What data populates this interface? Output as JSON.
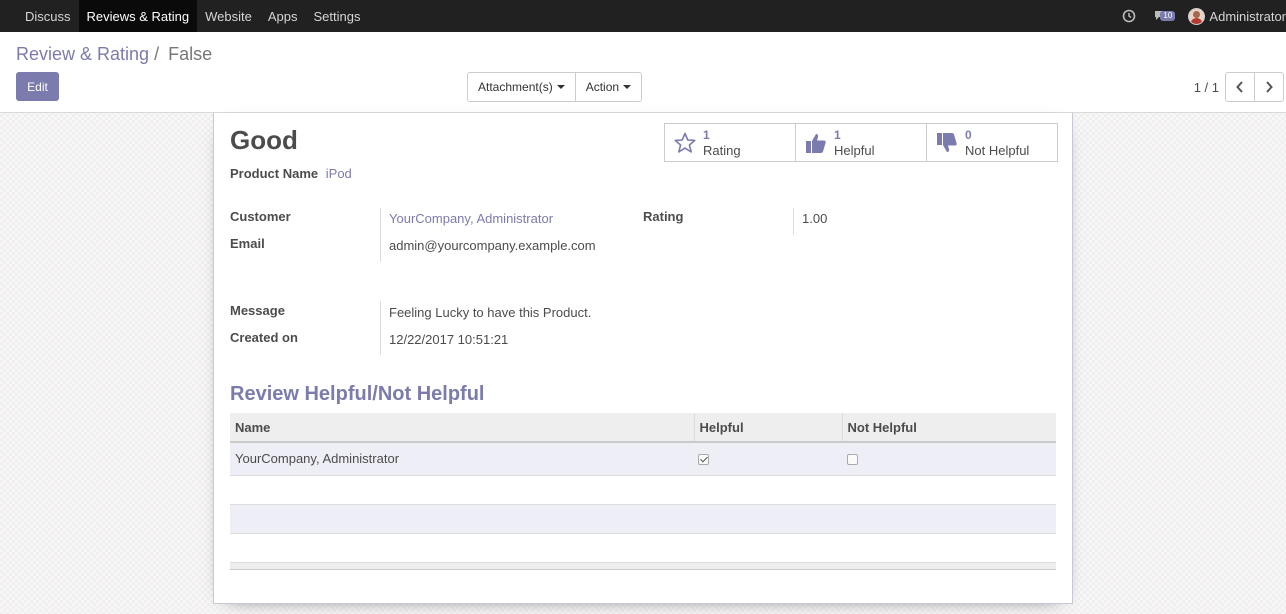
{
  "navbar": {
    "menu": [
      "Discuss",
      "Reviews & Rating",
      "Website",
      "Apps",
      "Settings"
    ],
    "active_index": 1,
    "chat_count": "10",
    "user_name": "Administrator"
  },
  "control_panel": {
    "breadcrumb_parent": "Review & Rating",
    "breadcrumb_separator": "/",
    "breadcrumb_current": "False",
    "edit_label": "Edit",
    "attachments_label": "Attachment(s)",
    "action_label": "Action",
    "pager_value": "1 / 1"
  },
  "form": {
    "title": "Good",
    "product_label": "Product Name",
    "product_value": "iPod",
    "stat_buttons": [
      {
        "value": "1",
        "label": "Rating",
        "icon": "star-icon"
      },
      {
        "value": "1",
        "label": "Helpful",
        "icon": "thumbs-up-icon"
      },
      {
        "value": "0",
        "label": "Not Helpful",
        "icon": "thumbs-down-icon"
      }
    ],
    "customer_label": "Customer",
    "customer_value": "YourCompany, Administrator",
    "email_label": "Email",
    "email_value": "admin@yourcompany.example.com",
    "rating_label": "Rating",
    "rating_value": "1.00",
    "message_label": "Message",
    "message_value": "Feeling Lucky to have this Product.",
    "created_label": "Created on",
    "created_value": "12/22/2017 10:51:21",
    "section_title": "Review Helpful/Not Helpful",
    "table": {
      "columns": [
        "Name",
        "Helpful",
        "Not Helpful"
      ],
      "rows": [
        {
          "name": "YourCompany, Administrator",
          "helpful": true,
          "not_helpful": false
        }
      ]
    }
  },
  "colors": {
    "brand": "#7c7bad",
    "navbar": "#212121"
  }
}
